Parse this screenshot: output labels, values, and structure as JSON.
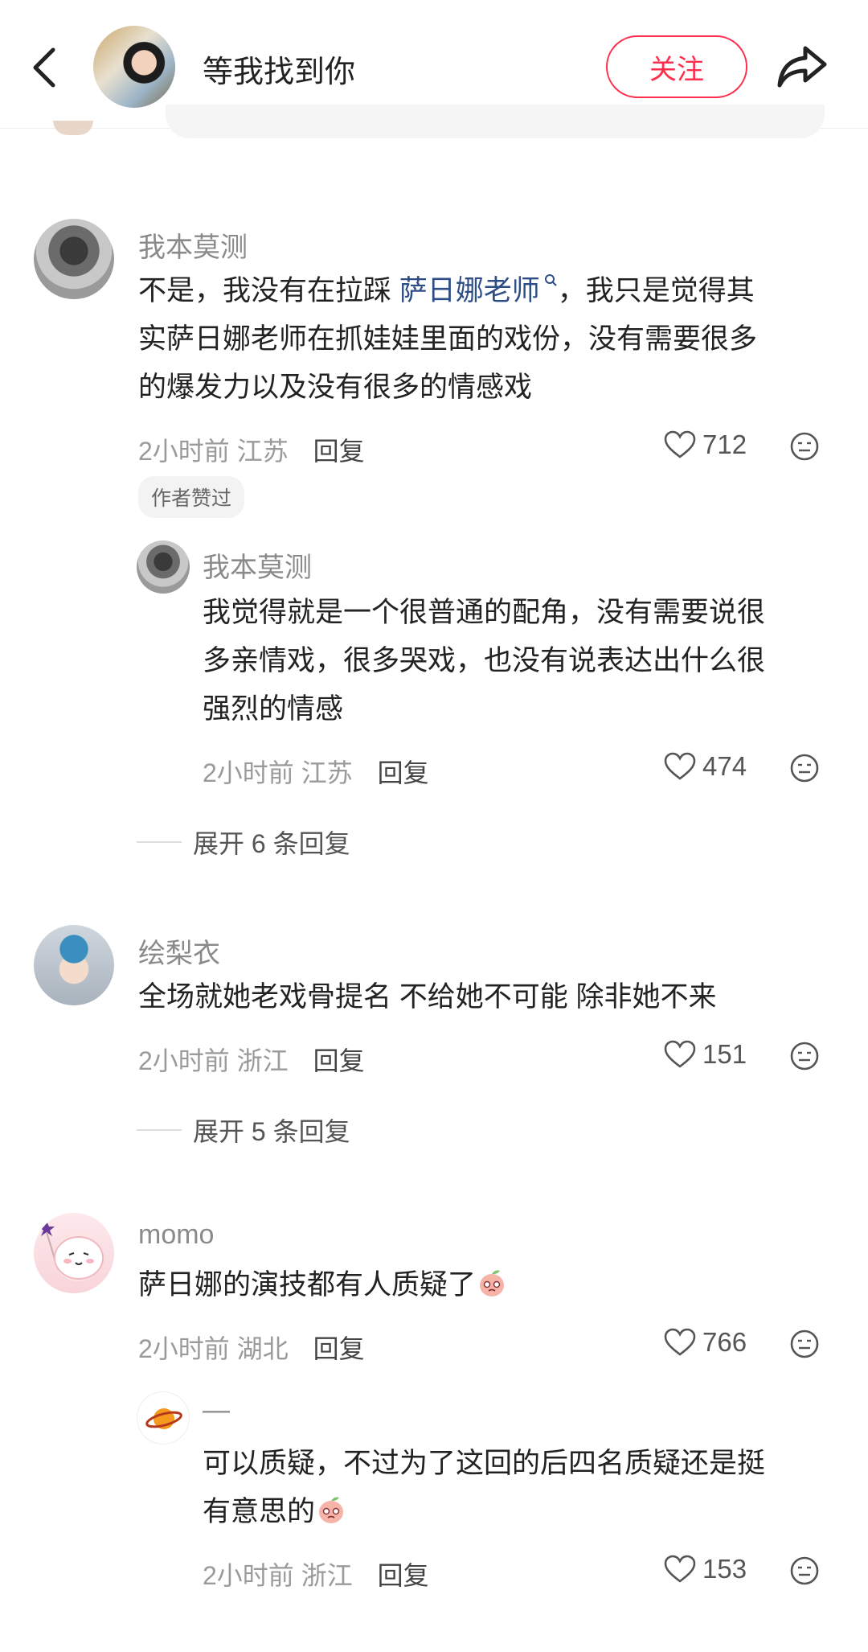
{
  "header": {
    "title": "等我找到你",
    "follow_label": "关注"
  },
  "comments": [
    {
      "username": "我本莫测",
      "text_before": "不是，我没有在拉踩 ",
      "link": "萨日娜老师",
      "text_line1_after": "，我只是觉得其",
      "text_line2": "实萨日娜老师在抓娃娃里面的戏份，没有需要很多",
      "text_line3": "的爆发力以及没有很多的情感戏",
      "time": "2小时前",
      "location": "江苏",
      "reply_label": "回复",
      "likes": "712",
      "badge": "作者赞过",
      "reply": {
        "username": "我本莫测",
        "line1": "我觉得就是一个很普通的配角，没有需要说很",
        "line2": "多亲情戏，很多哭戏，也没有说表达出什么很",
        "line3": "强烈的情感",
        "time": "2小时前",
        "location": "江苏",
        "reply_label": "回复",
        "likes": "474"
      },
      "expand_label": "展开 6 条回复"
    },
    {
      "username": "绘梨衣",
      "line1": "全场就她老戏骨提名 不给她不可能 除非她不来",
      "time": "2小时前",
      "location": "浙江",
      "reply_label": "回复",
      "likes": "151",
      "expand_label": "展开 5 条回复"
    },
    {
      "username": "momo",
      "line1": "萨日娜的演技都有人质疑了",
      "time": "2小时前",
      "location": "湖北",
      "reply_label": "回复",
      "likes": "766",
      "reply": {
        "username": "—",
        "line1": "可以质疑，不过为了这回的后四名质疑还是挺",
        "line2": "有意思的",
        "time": "2小时前",
        "location": "浙江",
        "reply_label": "回复",
        "likes": "153"
      }
    }
  ]
}
